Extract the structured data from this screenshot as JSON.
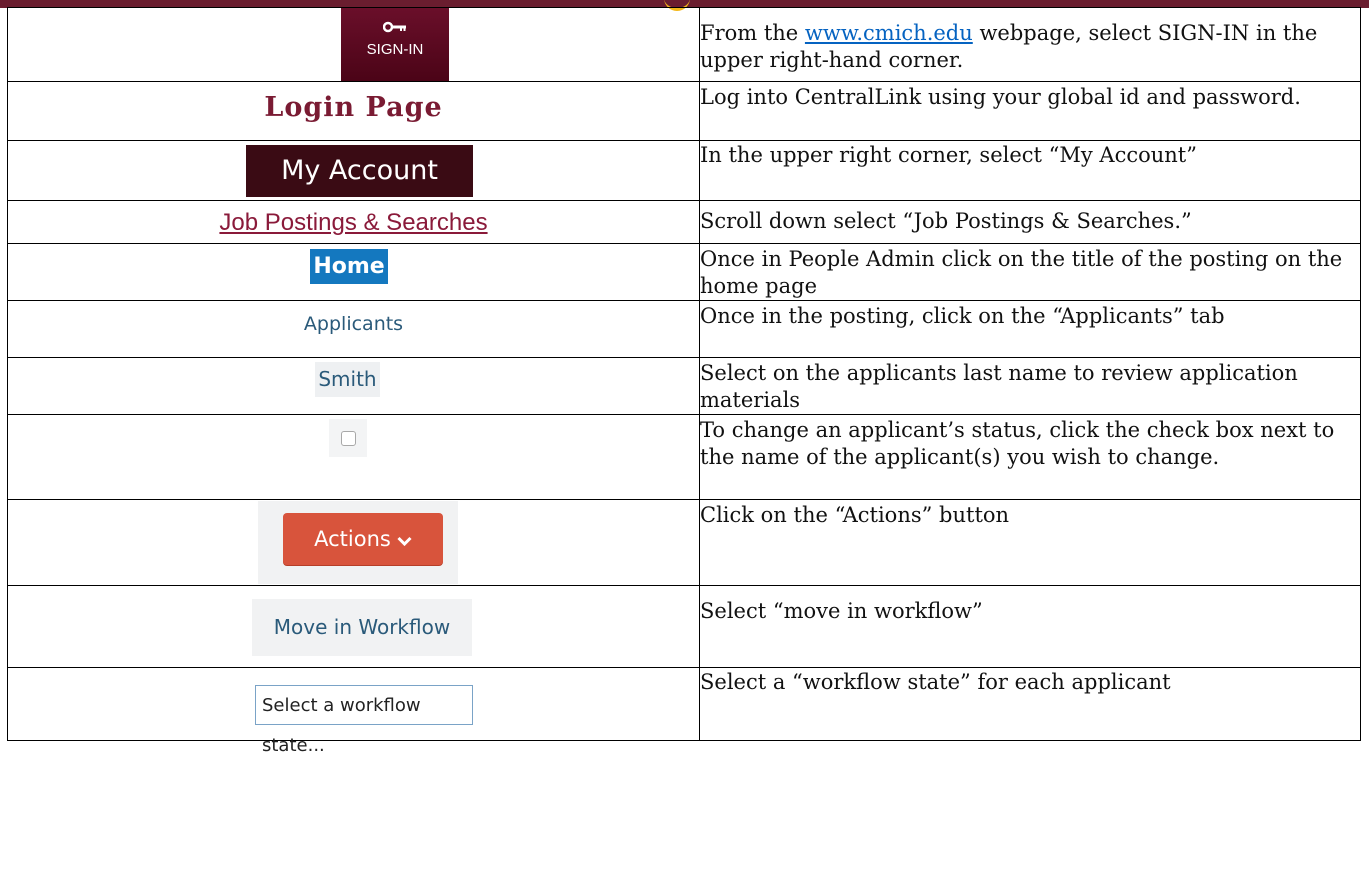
{
  "rows": [
    {
      "widget": {
        "type": "sign-in-tile",
        "label": "SIGN-IN"
      },
      "instruction": {
        "before": "From the ",
        "link": "www.cmich.edu",
        "after": " webpage, select SIGN-IN in the upper right-hand corner."
      }
    },
    {
      "widget": {
        "type": "heading",
        "label": "Login Page"
      },
      "instruction": "Log into CentralLink using your global id and password."
    },
    {
      "widget": {
        "type": "button",
        "label": "My Account"
      },
      "instruction": "In the upper right corner, select “My Account”"
    },
    {
      "widget": {
        "type": "link",
        "label": "Job Postings & Searches"
      },
      "instruction": "Scroll down select “Job Postings & Searches.”"
    },
    {
      "widget": {
        "type": "button",
        "label": "Home"
      },
      "instruction": "Once in People Admin click on the title of the posting on the home page"
    },
    {
      "widget": {
        "type": "tab",
        "label": "Applicants"
      },
      "instruction": "Once in the posting, click on the “Applicants” tab"
    },
    {
      "widget": {
        "type": "link",
        "label": "Smith"
      },
      "instruction": "Select on the applicants last name to review application materials"
    },
    {
      "widget": {
        "type": "checkbox",
        "checked": false
      },
      "instruction": "To change an applicant’s status, click the check box next to the name of the applicant(s) you wish to change."
    },
    {
      "widget": {
        "type": "button",
        "label": "Actions",
        "icon": "chevron-down-icon",
        "color": "#d8543c"
      },
      "instruction": "Click on the “Actions” button"
    },
    {
      "widget": {
        "type": "menu-item",
        "label": "Move in Workflow"
      },
      "instruction": "Select “move in workflow”"
    },
    {
      "widget": {
        "type": "select",
        "placeholder": "Select a workflow state..."
      },
      "instruction": "Select a “workflow state” for each applicant"
    }
  ],
  "colors": {
    "maroon": "#6a1d2f",
    "gold": "#f3b81a",
    "link_blue": "#0563c1",
    "home_blue": "#1478bf"
  }
}
